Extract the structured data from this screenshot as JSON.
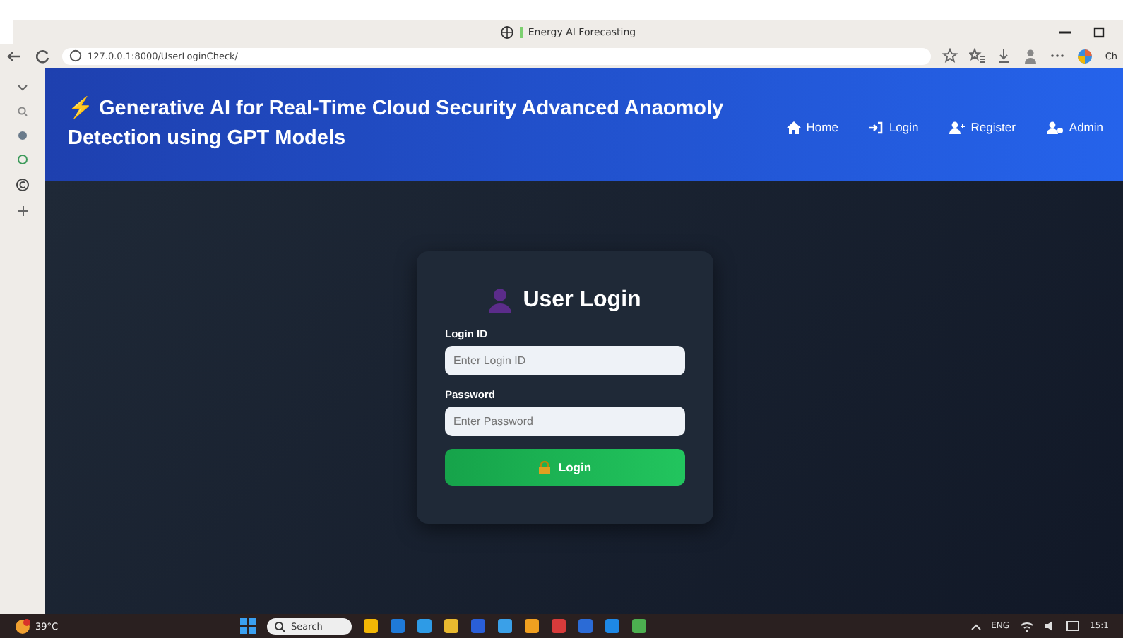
{
  "browser": {
    "tab_title": "Energy AI Forecasting",
    "url": "127.0.0.1:8000/UserLoginCheck/",
    "profile_label": "Ch"
  },
  "header": {
    "icon": "⚡",
    "title": "Generative AI for Real-Time Cloud Security Advanced Anaomoly Detection using GPT Models",
    "nav": [
      {
        "kind": "home",
        "label": "Home"
      },
      {
        "kind": "login",
        "label": "Login"
      },
      {
        "kind": "register",
        "label": "Register"
      },
      {
        "kind": "admin",
        "label": "Admin"
      }
    ]
  },
  "login": {
    "title": "User Login",
    "fields": [
      {
        "label": "Login ID",
        "placeholder": "Enter Login ID"
      },
      {
        "label": "Password",
        "placeholder": "Enter Password"
      }
    ],
    "button": "Login"
  },
  "taskbar": {
    "weather": "39°C",
    "search": "Search",
    "language": "ENG",
    "time": "15:1"
  }
}
